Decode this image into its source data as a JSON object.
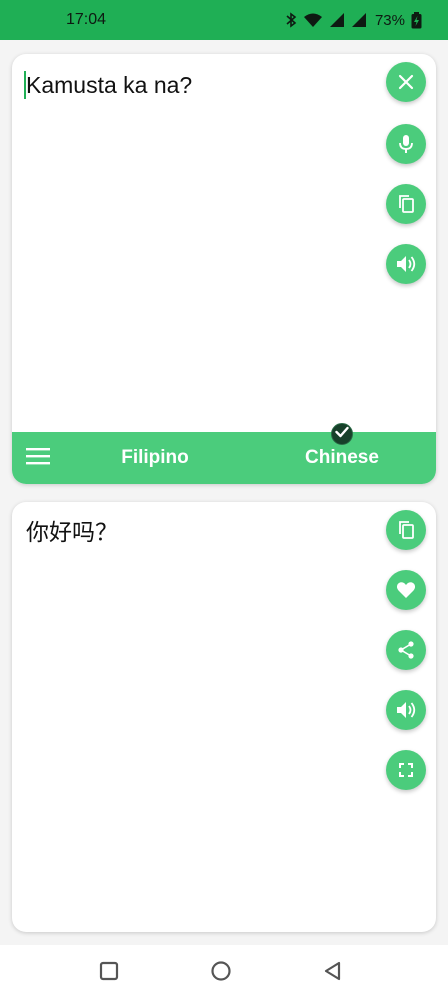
{
  "status_bar": {
    "time": "17:04",
    "battery": "73%",
    "icons": [
      "bluetooth-icon",
      "wifi-icon",
      "signal-icon",
      "signal-icon",
      "battery-icon"
    ]
  },
  "source_panel": {
    "text": "Kamusta ka na?",
    "actions": [
      "close-icon",
      "microphone-icon",
      "copy-icon",
      "speaker-icon"
    ]
  },
  "language_bar": {
    "source_language": "Filipino",
    "target_language": "Chinese",
    "menu_icon": "menu-icon",
    "selected_indicator": "check-icon"
  },
  "target_panel": {
    "text": "你好吗？",
    "actions": [
      "copy-icon",
      "heart-icon",
      "share-icon",
      "speaker-icon",
      "fullscreen-icon"
    ]
  },
  "colors": {
    "status_bar": "#1faf55",
    "accent": "#4bcc7c",
    "badge": "#17402a"
  }
}
